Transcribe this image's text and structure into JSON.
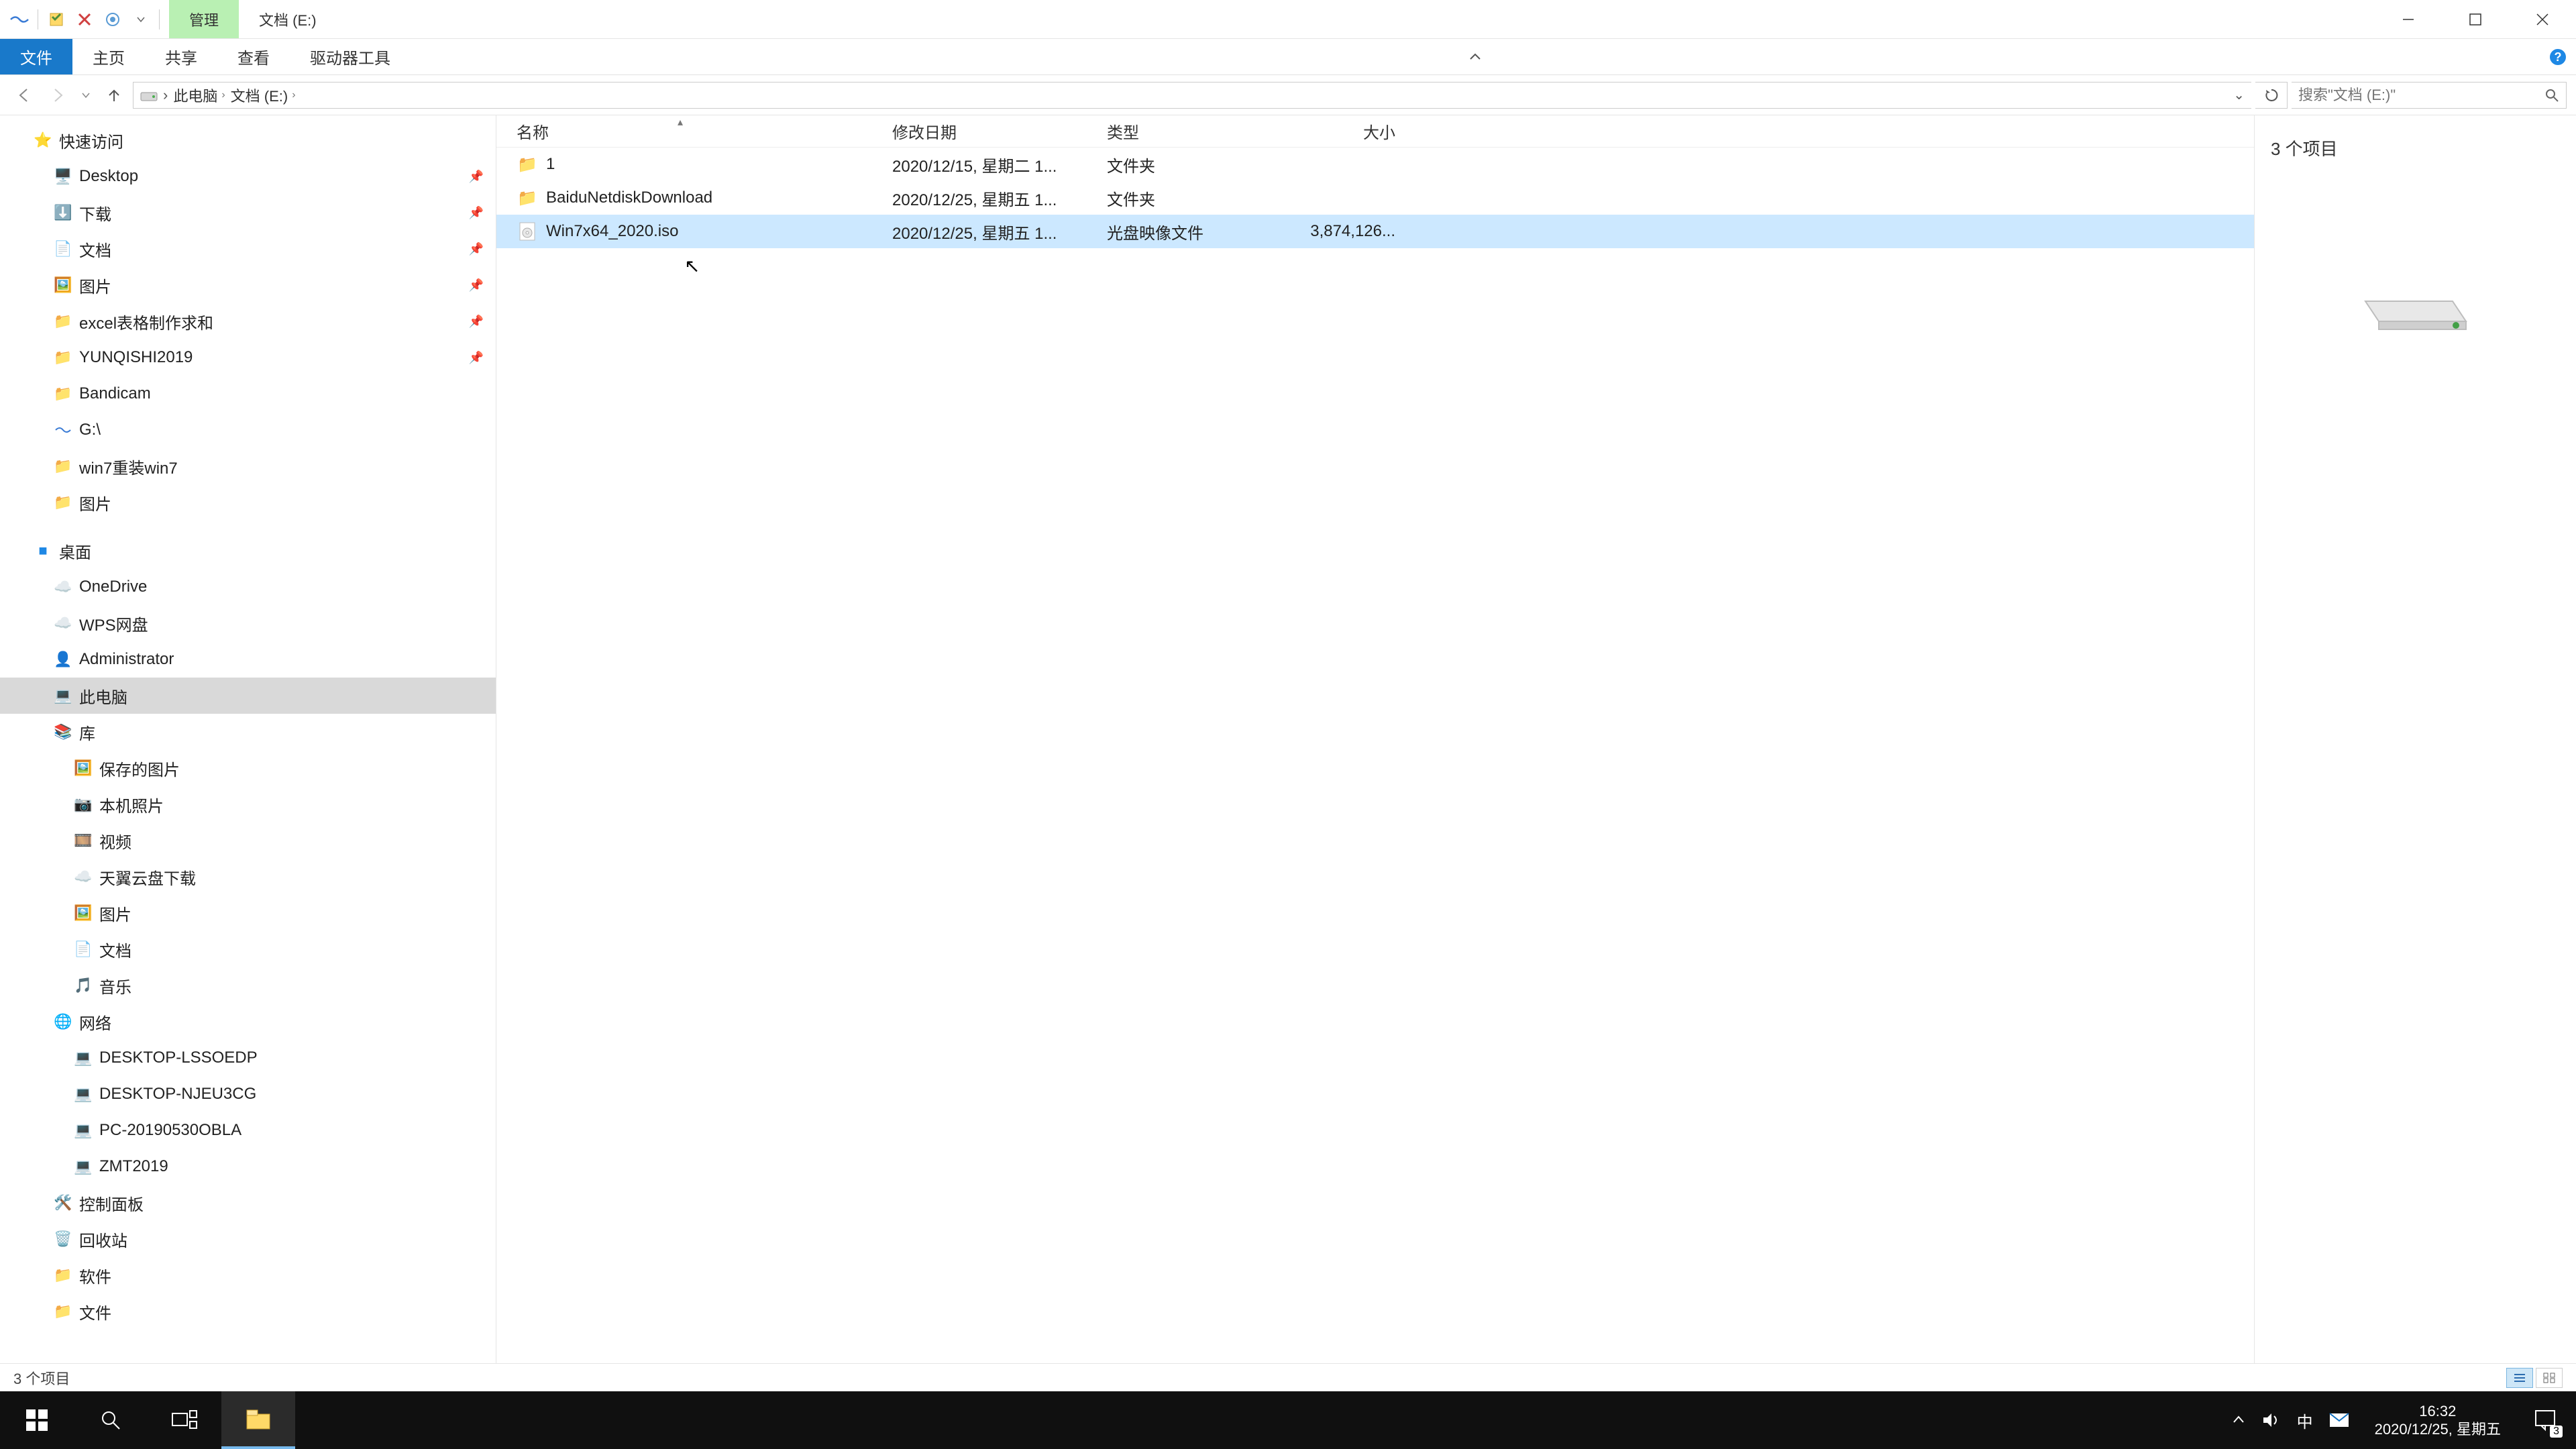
{
  "window": {
    "manage_tab": "管理",
    "title_tab": "文档 (E:)"
  },
  "ribbon": {
    "file": "文件",
    "home": "主页",
    "share": "共享",
    "view": "查看",
    "drive": "驱动器工具"
  },
  "addr": {
    "pc": "此电脑",
    "loc": "文档 (E:)"
  },
  "search": {
    "placeholder": "搜索\"文档 (E:)\""
  },
  "nav": {
    "quick": "快速访问",
    "desktop": "Desktop",
    "downloads": "下载",
    "documents": "文档",
    "pictures": "图片",
    "excel": "excel表格制作求和",
    "yunqishi": "YUNQISHI2019",
    "bandicam": "Bandicam",
    "g": "G:\\",
    "win7": "win7重装win7",
    "pictures2": "图片",
    "desktop_zh": "桌面",
    "onedrive": "OneDrive",
    "wps": "WPS网盘",
    "admin": "Administrator",
    "thispc": "此电脑",
    "lib": "库",
    "savedpics": "保存的图片",
    "camera": "本机照片",
    "video": "视频",
    "tianyi": "天翼云盘下载",
    "pics3": "图片",
    "docs3": "文档",
    "music": "音乐",
    "network": "网络",
    "net1": "DESKTOP-LSSOEDP",
    "net2": "DESKTOP-NJEU3CG",
    "net3": "PC-20190530OBLA",
    "net4": "ZMT2019",
    "cpanel": "控制面板",
    "recycle": "回收站",
    "soft": "软件",
    "files": "文件"
  },
  "cols": {
    "name": "名称",
    "date": "修改日期",
    "type": "类型",
    "size": "大小"
  },
  "rows": [
    {
      "name": "1",
      "date": "2020/12/15, 星期二 1...",
      "type": "文件夹",
      "size": ""
    },
    {
      "name": "BaiduNetdiskDownload",
      "date": "2020/12/25, 星期五 1...",
      "type": "文件夹",
      "size": ""
    },
    {
      "name": "Win7x64_2020.iso",
      "date": "2020/12/25, 星期五 1...",
      "type": "光盘映像文件",
      "size": "3,874,126..."
    }
  ],
  "preview": {
    "count": "3 个项目"
  },
  "status": {
    "count": "3 个项目"
  },
  "tray": {
    "ime": "中",
    "time": "16:32",
    "date": "2020/12/25, 星期五",
    "notif_count": "3"
  }
}
